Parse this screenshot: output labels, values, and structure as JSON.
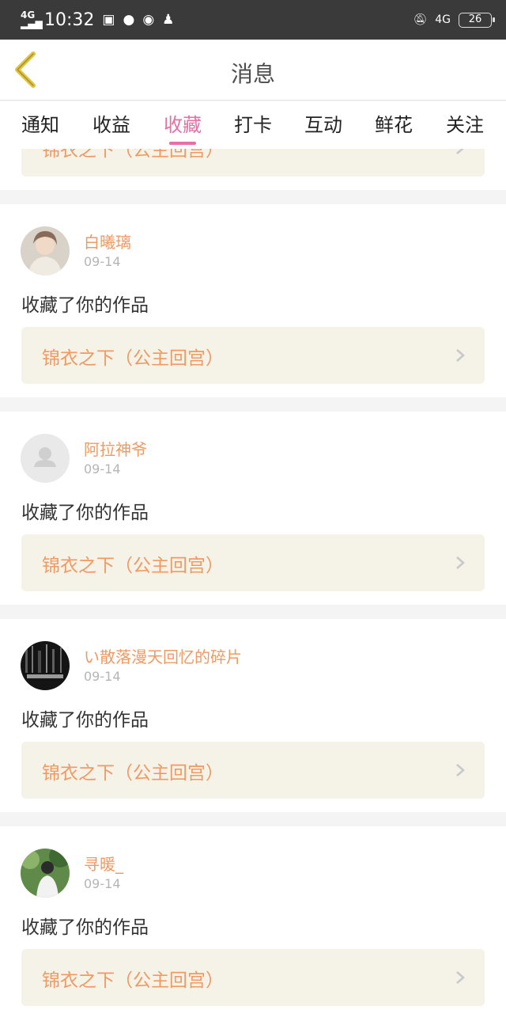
{
  "status_bar": {
    "network_left": "4G",
    "time": "10:32",
    "network_right": "4G",
    "battery": "26"
  },
  "header": {
    "title": "消息"
  },
  "tabs": [
    "通知",
    "收益",
    "收藏",
    "打卡",
    "互动",
    "鲜花",
    "关注"
  ],
  "active_tab": "收藏",
  "partial_item": {
    "work_title": "锦衣之下（公主回宫）"
  },
  "items": [
    {
      "name": "白曦璃",
      "date": "09-14",
      "action": "收藏了你的作品",
      "work_title": "锦衣之下（公主回宫）"
    },
    {
      "name": "阿拉神爷",
      "date": "09-14",
      "action": "收藏了你的作品",
      "work_title": "锦衣之下（公主回宫）"
    },
    {
      "name": "い散落漫天回忆的碎片",
      "date": "09-14",
      "action": "收藏了你的作品",
      "work_title": "锦衣之下（公主回宫）"
    },
    {
      "name": "寻暖_",
      "date": "09-14",
      "action": "收藏了你的作品",
      "work_title": "锦衣之下（公主回宫）"
    }
  ],
  "colors": {
    "accent": "#e56fa6",
    "name": "#ef9a64",
    "work_bg": "#f5f3e8"
  }
}
